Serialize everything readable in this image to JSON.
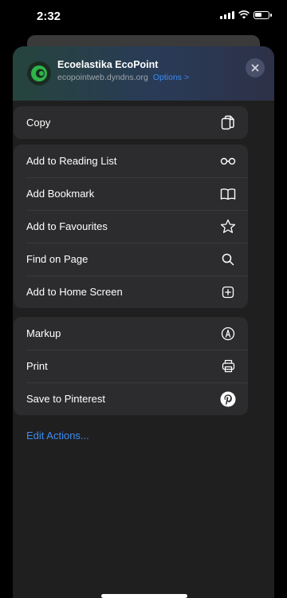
{
  "status": {
    "time": "2:32"
  },
  "header": {
    "title": "Ecoelastika EcoPoint",
    "url": "ecopointweb.dyndns.org",
    "options": "Options >"
  },
  "groups": {
    "copy": [
      {
        "label": "Copy",
        "icon": "copy-icon"
      }
    ],
    "actions": [
      {
        "label": "Add to Reading List",
        "icon": "glasses-icon"
      },
      {
        "label": "Add Bookmark",
        "icon": "book-icon"
      },
      {
        "label": "Add to Favourites",
        "icon": "star-icon"
      },
      {
        "label": "Find on Page",
        "icon": "search-icon"
      },
      {
        "label": "Add to Home Screen",
        "icon": "plus-square-icon"
      }
    ],
    "extensions": [
      {
        "label": "Markup",
        "icon": "markup-icon"
      },
      {
        "label": "Print",
        "icon": "printer-icon"
      },
      {
        "label": "Save to Pinterest",
        "icon": "pinterest-icon"
      }
    ]
  },
  "edit_actions": "Edit Actions...",
  "colors": {
    "accent": "#3d8bf2",
    "row_bg": "#2c2c2e",
    "sheet_bg": "#1f1f1f"
  }
}
